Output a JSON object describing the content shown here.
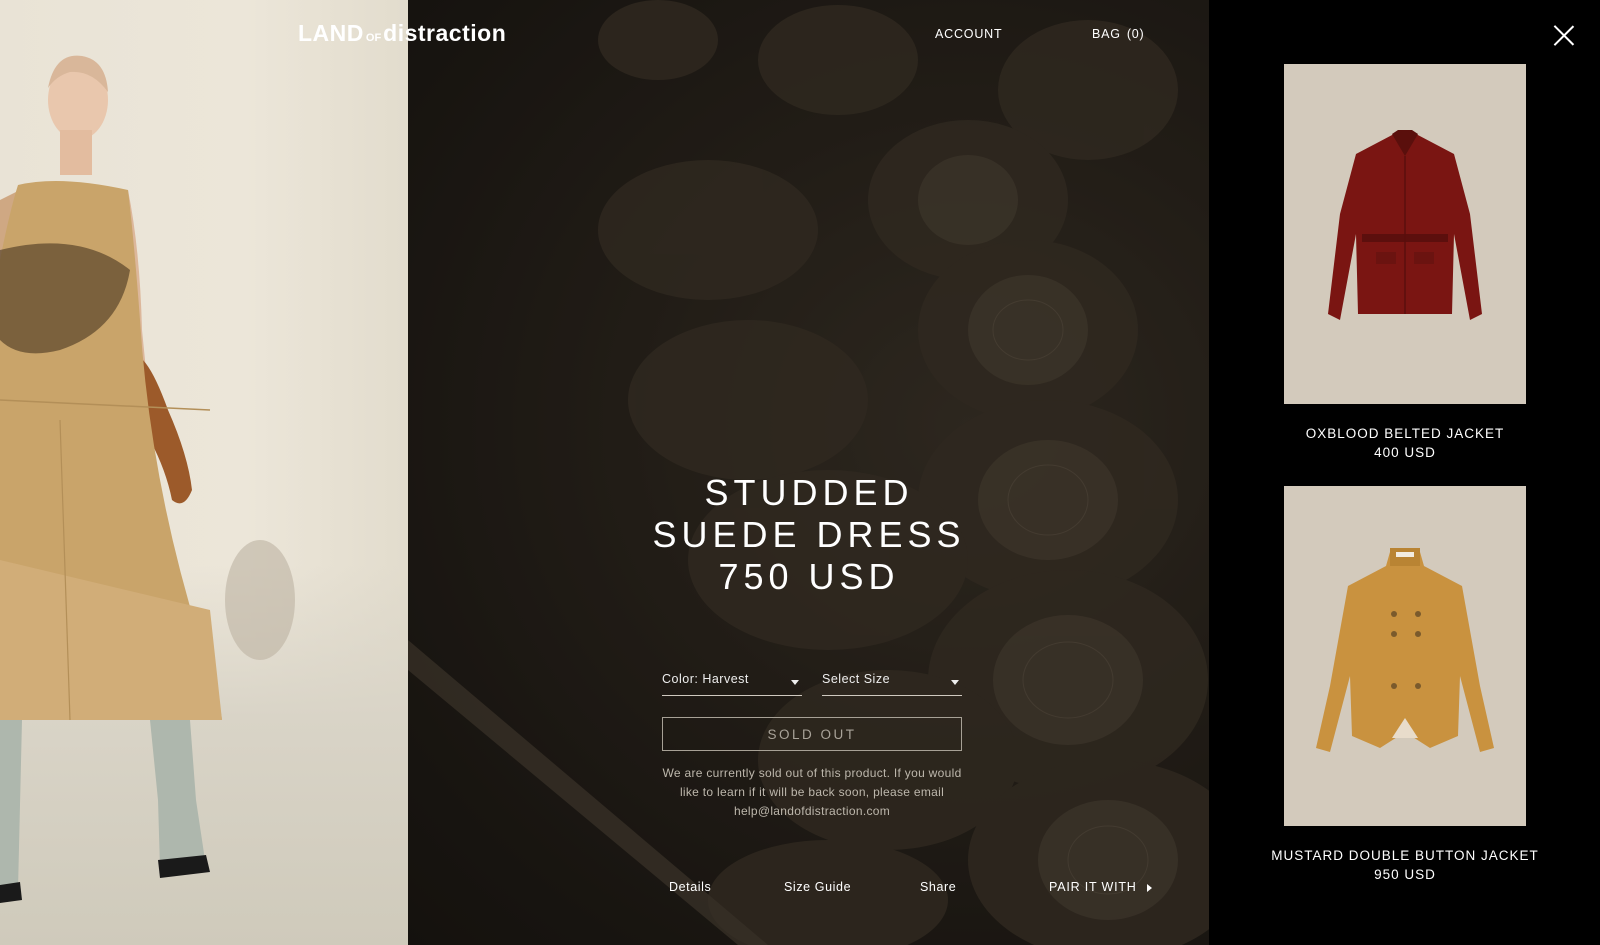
{
  "header": {
    "logo_main": "LAND",
    "logo_small": "OF",
    "logo_end": "distraction",
    "account_label": "ACCOUNT",
    "bag_label": "BAG",
    "bag_count": "(0)"
  },
  "product": {
    "title_line1": "STUDDED",
    "title_line2": "SUEDE DRESS",
    "price": "750 USD",
    "color_select": "Color: Harvest",
    "size_select": "Select Size",
    "sold_out_label": "SOLD OUT",
    "sold_out_message": "We are currently sold out of this product. If you would like to learn if it will be back soon, please email help@landofdistraction.com"
  },
  "tabs": {
    "details": "Details",
    "size_guide": "Size Guide",
    "share": "Share",
    "pair_it_with": "PAIR IT WITH"
  },
  "sidebar": {
    "items": [
      {
        "name": "OXBLOOD BELTED JACKET",
        "price": "400 USD",
        "color": "#7a1512"
      },
      {
        "name": "MUSTARD DOUBLE BUTTON JACKET",
        "price": "950 USD",
        "color": "#c9923f"
      }
    ]
  },
  "colors": {
    "sidebar_bg": "#000000",
    "card_bg": "#d3cabc",
    "text": "#ffffff"
  }
}
